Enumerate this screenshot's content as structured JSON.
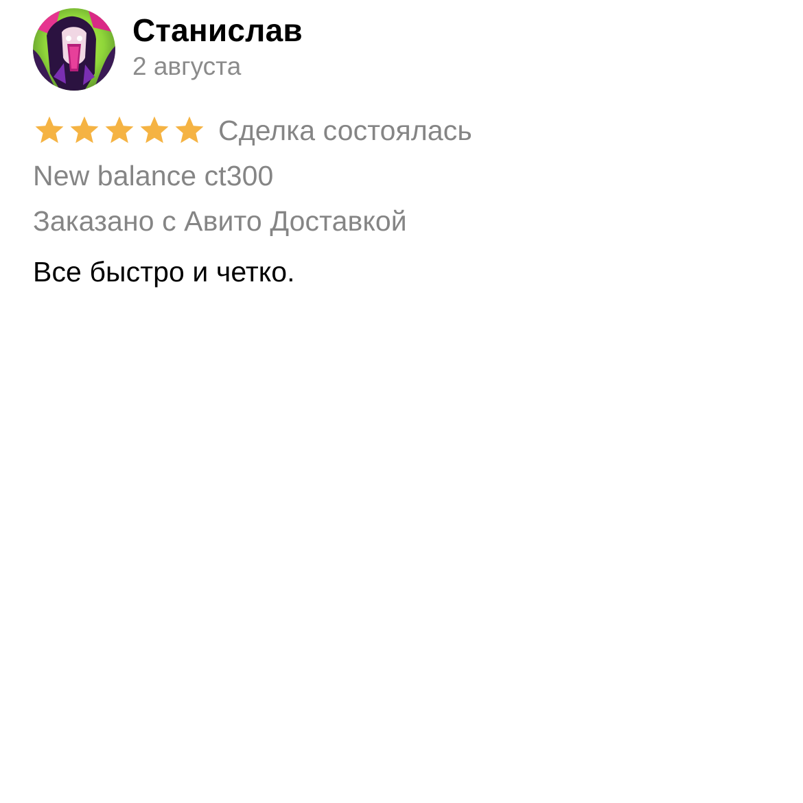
{
  "review": {
    "author_name": "Станислав",
    "date": "2 августа",
    "rating": 5,
    "rating_max": 5,
    "deal_status": "Сделка состоялась",
    "item_name": "New balance ct300",
    "delivery_note": "Заказано с Авито Доставкой",
    "text": "Все быстро и четко."
  },
  "icons": {
    "avatar": "user-avatar-illustration",
    "star": "star-icon"
  },
  "colors": {
    "star_filled": "#F5B343",
    "secondary_text": "#858585",
    "primary_text": "#000000",
    "background": "#FFFFFF"
  }
}
